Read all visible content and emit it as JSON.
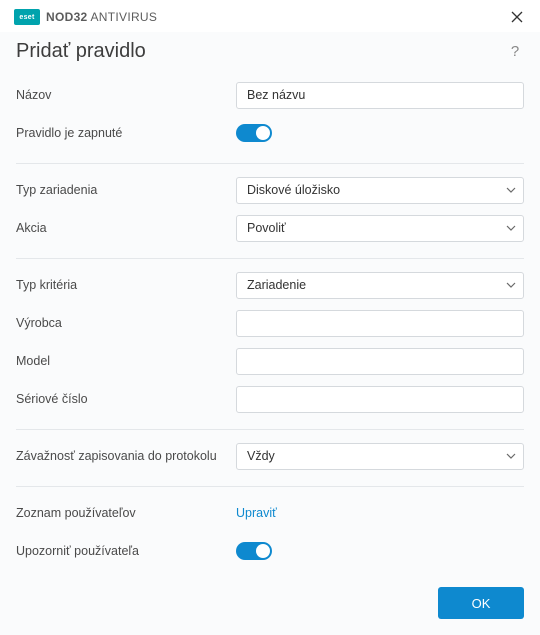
{
  "brand": {
    "logo_text": "eset",
    "product_bold": "NOD32",
    "product_rest": " ANTIVIRUS"
  },
  "header": {
    "title": "Pridať pravidlo",
    "help": "?"
  },
  "fields": {
    "name": {
      "label": "Názov",
      "value": "Bez názvu"
    },
    "enabled": {
      "label": "Pravidlo je zapnuté"
    },
    "device_type": {
      "label": "Typ zariadenia",
      "value": "Diskové úložisko"
    },
    "action": {
      "label": "Akcia",
      "value": "Povoliť"
    },
    "criteria_type": {
      "label": "Typ kritéria",
      "value": "Zariadenie"
    },
    "vendor": {
      "label": "Výrobca",
      "value": ""
    },
    "model": {
      "label": "Model",
      "value": ""
    },
    "serial": {
      "label": "Sériové číslo",
      "value": ""
    },
    "log_severity": {
      "label": "Závažnosť zapisovania do protokolu",
      "value": "Vždy"
    },
    "user_list": {
      "label": "Zoznam používateľov",
      "link_text": "Upraviť"
    },
    "notify_user": {
      "label": "Upozorniť používateľa"
    }
  },
  "buttons": {
    "ok": "OK"
  }
}
